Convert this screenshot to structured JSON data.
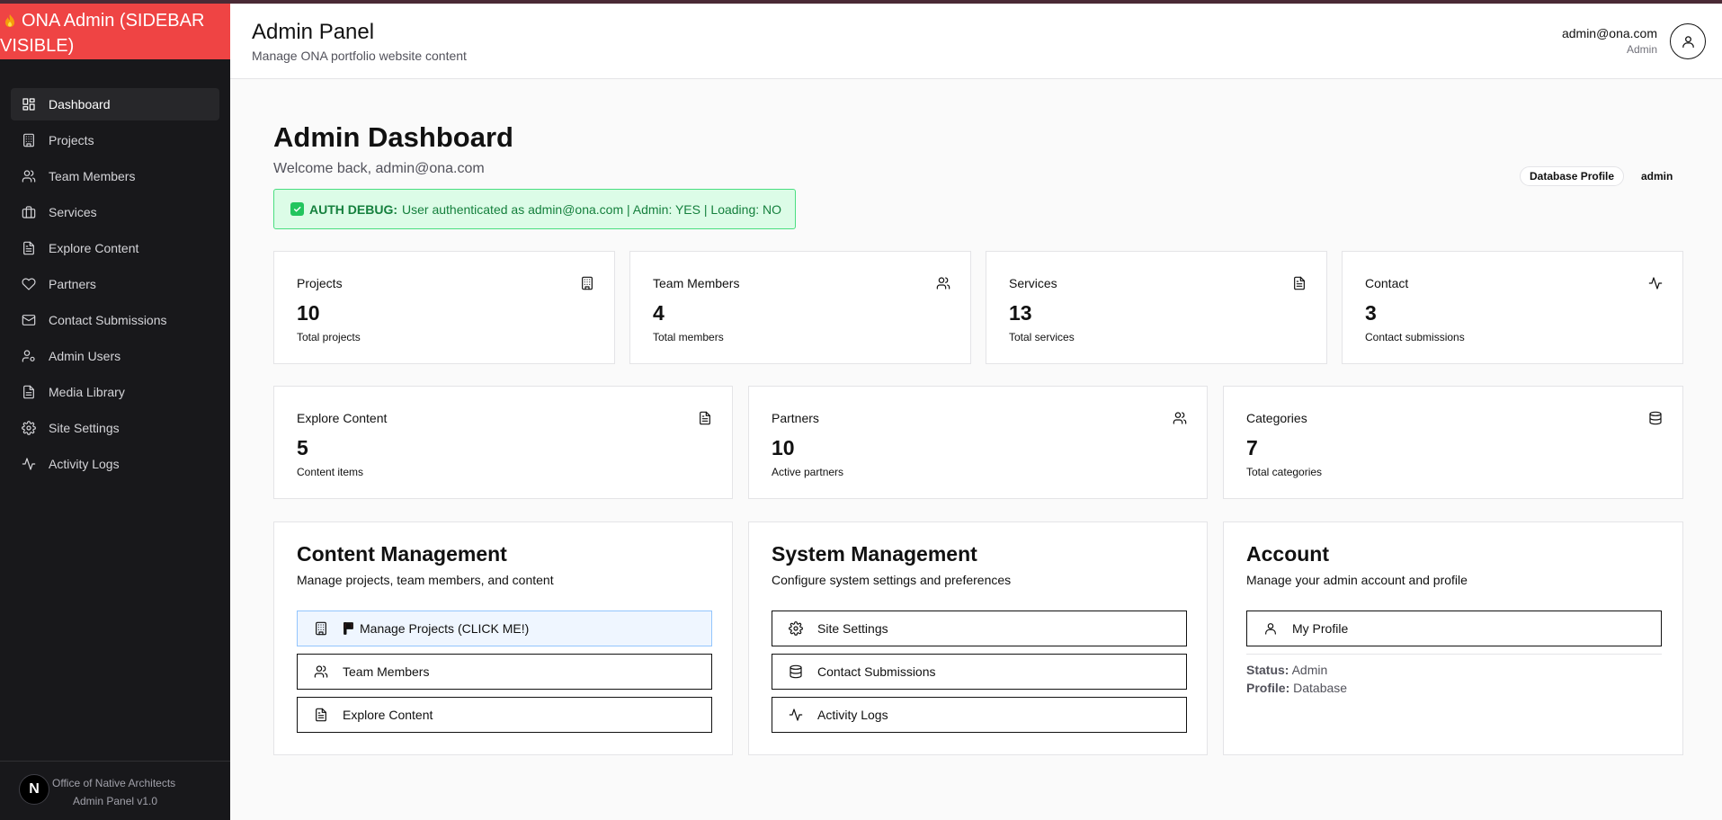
{
  "sidebar": {
    "brand": "ONA Admin (SIDEBAR VISIBLE)",
    "items": [
      {
        "label": "Dashboard",
        "icon": "dashboard-icon",
        "active": true
      },
      {
        "label": "Projects",
        "icon": "building-icon"
      },
      {
        "label": "Team Members",
        "icon": "users-icon"
      },
      {
        "label": "Services",
        "icon": "briefcase-icon"
      },
      {
        "label": "Explore Content",
        "icon": "file-icon"
      },
      {
        "label": "Partners",
        "icon": "heart-icon"
      },
      {
        "label": "Contact Submissions",
        "icon": "mail-icon"
      },
      {
        "label": "Admin Users",
        "icon": "user-cog-icon"
      },
      {
        "label": "Media Library",
        "icon": "file-icon"
      },
      {
        "label": "Site Settings",
        "icon": "gear-icon"
      },
      {
        "label": "Activity Logs",
        "icon": "activity-icon"
      }
    ],
    "footer_logo": "N",
    "footer_org": "Office of Native Architects",
    "footer_version": "Admin Panel v1.0"
  },
  "header": {
    "title": "Admin Panel",
    "subtitle": "Manage ONA portfolio website content",
    "user_email": "admin@ona.com",
    "user_role": "Admin"
  },
  "main": {
    "title": "Admin Dashboard",
    "welcome": "Welcome back, admin@ona.com",
    "badge_profile": "Database Profile",
    "badge_role": "admin",
    "debug_label": "AUTH DEBUG:",
    "debug_text": "User authenticated as admin@ona.com | Admin: YES | Loading: NO",
    "stats": [
      {
        "label": "Projects",
        "value": "10",
        "desc": "Total projects",
        "icon": "building-icon"
      },
      {
        "label": "Team Members",
        "value": "4",
        "desc": "Total members",
        "icon": "users-icon"
      },
      {
        "label": "Services",
        "value": "13",
        "desc": "Total services",
        "icon": "file-icon"
      },
      {
        "label": "Contact",
        "value": "3",
        "desc": "Contact submissions",
        "icon": "activity-icon"
      },
      {
        "label": "Explore Content",
        "value": "5",
        "desc": "Content items",
        "icon": "file-icon"
      },
      {
        "label": "Partners",
        "value": "10",
        "desc": "Active partners",
        "icon": "users-icon"
      },
      {
        "label": "Categories",
        "value": "7",
        "desc": "Total categories",
        "icon": "database-icon"
      }
    ],
    "sections": {
      "content": {
        "title": "Content Management",
        "subtitle": "Manage projects, team members, and content",
        "buttons": [
          "Manage Projects (CLICK ME!)",
          "Team Members",
          "Explore Content"
        ]
      },
      "system": {
        "title": "System Management",
        "subtitle": "Configure system settings and preferences",
        "buttons": [
          "Site Settings",
          "Contact Submissions",
          "Activity Logs"
        ]
      },
      "account": {
        "title": "Account",
        "subtitle": "Manage your admin account and profile",
        "button": "My Profile",
        "status_label": "Status:",
        "status_value": "Admin",
        "profile_label": "Profile:",
        "profile_value": "Database"
      }
    }
  },
  "colors": {
    "brand": "#ef4444",
    "sidebar_bg": "#18181b",
    "debug_bg": "#dcfce7",
    "debug_text": "#15803d"
  }
}
